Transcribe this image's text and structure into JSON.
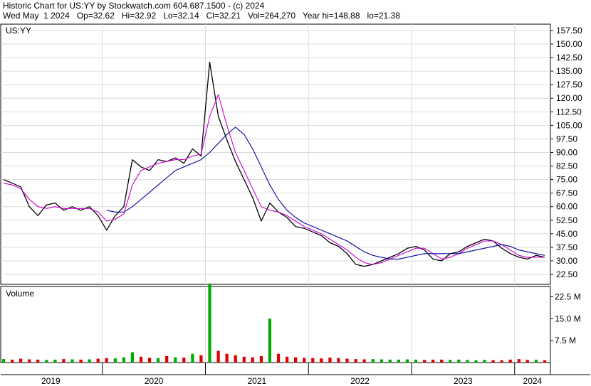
{
  "header": {
    "line1": "Historic Chart for US:YY by Stockwatch.com 604.687.1500 - (c) 2024",
    "line2": "Wed May  1 2024   Op=32.62   Hi=32.92   Lo=32.14   Cl=32.21   Vol=264,270   Year hi=148.88   lo=21.38"
  },
  "chart_data": [
    {
      "type": "line",
      "title": "US:YY",
      "x_labels": [
        "2019",
        "2020",
        "2021",
        "2022",
        "2023",
        "2024"
      ],
      "x_period": "monthly",
      "x": [
        "2019-01",
        "2019-02",
        "2019-03",
        "2019-04",
        "2019-05",
        "2019-06",
        "2019-07",
        "2019-08",
        "2019-09",
        "2019-10",
        "2019-11",
        "2019-12",
        "2020-01",
        "2020-02",
        "2020-03",
        "2020-04",
        "2020-05",
        "2020-06",
        "2020-07",
        "2020-08",
        "2020-09",
        "2020-10",
        "2020-11",
        "2020-12",
        "2021-01",
        "2021-02",
        "2021-03",
        "2021-04",
        "2021-05",
        "2021-06",
        "2021-07",
        "2021-08",
        "2021-09",
        "2021-10",
        "2021-11",
        "2021-12",
        "2022-01",
        "2022-02",
        "2022-03",
        "2022-04",
        "2022-05",
        "2022-06",
        "2022-07",
        "2022-08",
        "2022-09",
        "2022-10",
        "2022-11",
        "2022-12",
        "2023-01",
        "2023-02",
        "2023-03",
        "2023-04",
        "2023-05",
        "2023-06",
        "2023-07",
        "2023-08",
        "2023-09",
        "2023-10",
        "2023-11",
        "2023-12",
        "2024-01",
        "2024-02",
        "2024-03",
        "2024-04"
      ],
      "y_ticks": [
        "157.50",
        "150.00",
        "142.50",
        "135.00",
        "127.50",
        "120.00",
        "112.50",
        "105.00",
        "97.50",
        "90.00",
        "82.50",
        "75.00",
        "67.50",
        "60.00",
        "52.50",
        "45.00",
        "37.50",
        "30.00",
        "22.50"
      ],
      "ylim": [
        17,
        161
      ],
      "series": [
        {
          "kind": "price",
          "color": "#000000",
          "close": [
            75,
            73,
            71,
            60,
            55,
            61,
            62,
            58,
            60,
            58,
            60,
            55,
            47,
            55,
            60,
            86,
            82,
            80,
            86,
            85,
            87,
            84,
            92,
            88,
            140,
            110,
            97,
            85,
            75,
            65,
            52,
            62,
            57,
            54,
            49,
            48,
            46,
            44,
            40,
            38,
            34,
            28,
            27,
            28,
            30,
            32,
            34,
            37,
            38,
            36,
            31,
            30,
            34,
            35,
            38,
            40,
            42,
            41,
            37,
            34,
            32,
            31,
            33,
            32
          ]
        },
        {
          "kind": "short moving average",
          "color": "#cc00cc",
          "values": [
            73,
            72,
            70,
            64,
            60,
            59,
            60,
            59,
            59,
            59,
            59,
            57,
            52,
            53,
            56,
            72,
            80,
            82,
            84,
            85,
            86,
            86,
            88,
            89,
            110,
            122,
            105,
            90,
            80,
            70,
            60,
            58,
            57,
            55,
            52,
            49,
            47,
            45,
            42,
            39,
            36,
            32,
            29,
            28,
            29,
            31,
            33,
            35,
            37,
            37,
            34,
            31,
            32,
            34,
            37,
            39,
            41,
            41,
            39,
            36,
            33,
            32,
            32,
            32
          ]
        },
        {
          "kind": "long moving average",
          "color": "#000099",
          "values": [
            null,
            null,
            null,
            null,
            null,
            null,
            null,
            null,
            null,
            null,
            null,
            null,
            58,
            57,
            57,
            60,
            64,
            68,
            72,
            76,
            80,
            82,
            84,
            86,
            90,
            95,
            100,
            104,
            100,
            92,
            82,
            72,
            64,
            58,
            54,
            51,
            49,
            47,
            45,
            43,
            41,
            38,
            35,
            33,
            32,
            31,
            31,
            32,
            33,
            34,
            34,
            34,
            34,
            34,
            35,
            36,
            37,
            38,
            39,
            38,
            36,
            35,
            34,
            33
          ]
        }
      ]
    },
    {
      "type": "bar",
      "title": "Volume",
      "y_ticks": [
        "22.5 M",
        "15.0 M",
        "7.5 M"
      ],
      "ylim": [
        0,
        26
      ],
      "values_millions": [
        1.2,
        1.0,
        1.3,
        1.1,
        1.0,
        0.9,
        1.0,
        1.2,
        1.1,
        1.0,
        1.1,
        1.3,
        1.5,
        1.4,
        1.8,
        3.5,
        2.0,
        1.6,
        1.5,
        2.2,
        1.8,
        1.7,
        3.0,
        2.5,
        27.0,
        4.0,
        3.0,
        2.5,
        2.0,
        1.8,
        2.2,
        15.0,
        3.0,
        2.0,
        1.8,
        1.6,
        1.5,
        1.4,
        1.7,
        1.5,
        1.3,
        1.2,
        1.1,
        1.2,
        1.1,
        1.0,
        1.0,
        1.1,
        1.0,
        0.9,
        1.0,
        1.0,
        0.9,
        1.0,
        0.9,
        0.8,
        0.9,
        0.8,
        0.8,
        1.0,
        1.2,
        0.9,
        1.0,
        0.8
      ],
      "colors": {
        "up": "#00aa00",
        "down": "#dd0000"
      }
    }
  ]
}
